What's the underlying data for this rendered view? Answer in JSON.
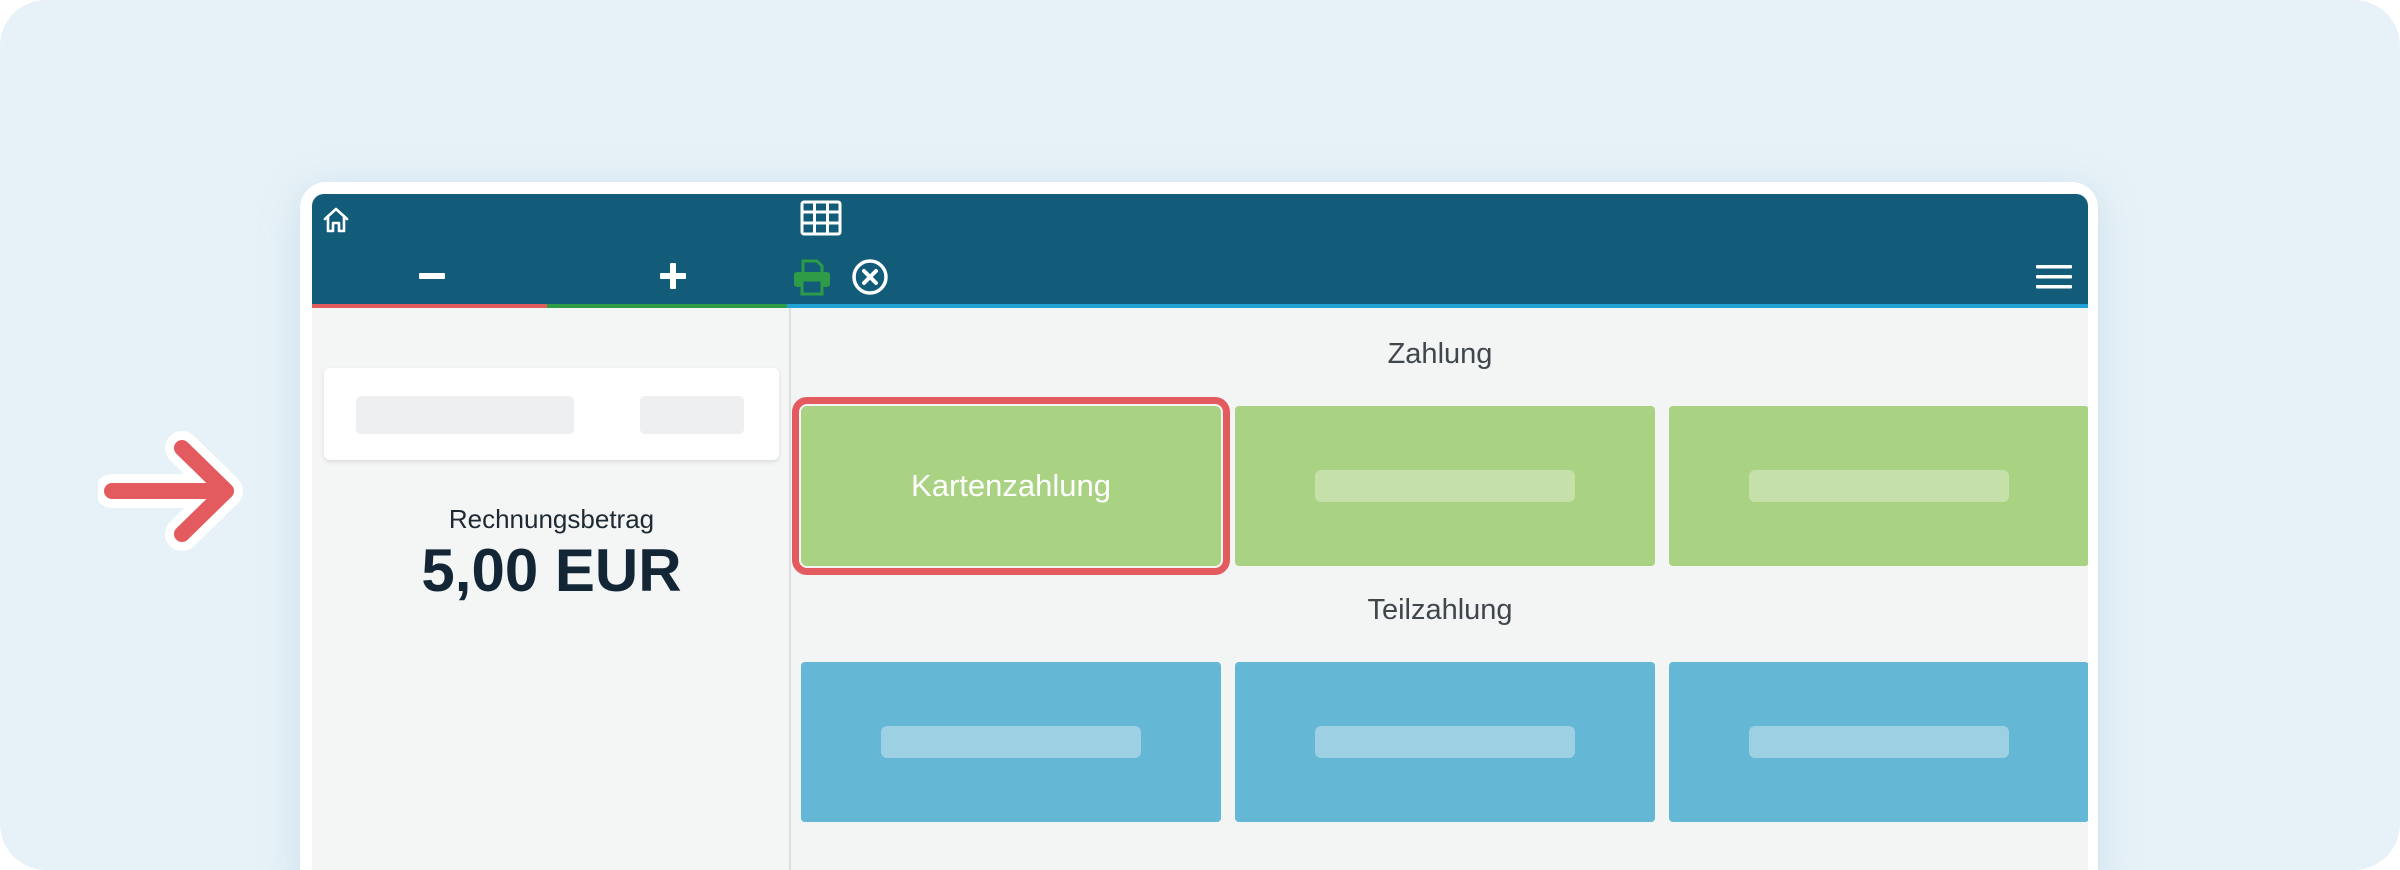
{
  "payment": {
    "amount_label": "Rechnungsbetrag",
    "amount_value": "5,00 EUR",
    "section_payment_title": "Zahlung",
    "section_partial_title": "Teilzahlung",
    "tiles": [
      {
        "label": "Kartenzahlung",
        "selected": true,
        "color": "#a9d283"
      }
    ]
  },
  "header": {
    "icons": [
      "home-icon",
      "table-grid-icon",
      "minus-icon",
      "plus-icon",
      "printer-icon",
      "cancel-circle-icon",
      "hamburger-menu-icon"
    ],
    "color": "#125c79"
  },
  "colors": {
    "payment_tile": "#a9d283",
    "partial_tile": "#64b7d5",
    "highlight": "#e35b5e",
    "print_icon": "#2e9b47"
  }
}
